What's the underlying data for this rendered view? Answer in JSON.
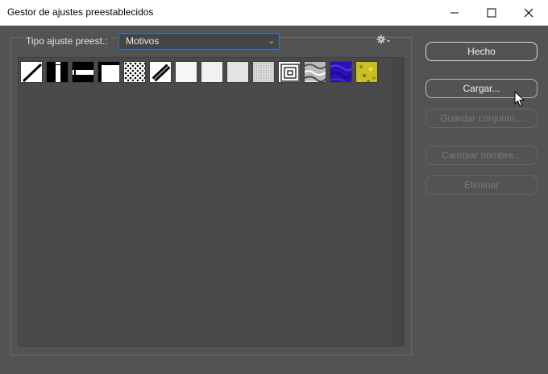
{
  "window": {
    "title": "Gestor de ajustes preestablecidos",
    "controls": [
      "minimize-icon",
      "maximize-icon",
      "close-icon"
    ]
  },
  "preset_type": {
    "label": "Tipo ajuste preest.:",
    "value": "Motivos"
  },
  "options_icon": "gear-icon",
  "patterns": [
    {
      "name": "diagonal-line-pattern",
      "fill": "#ffffff"
    },
    {
      "name": "vertical-bar-pattern",
      "fill": "#ffffff"
    },
    {
      "name": "horizontal-bar-pattern",
      "fill": "#ffffff"
    },
    {
      "name": "corner-pattern",
      "fill": "#ffffff"
    },
    {
      "name": "dots-pattern",
      "fill": "#ffffff"
    },
    {
      "name": "diagonal-block-pattern",
      "fill": "#ffffff"
    },
    {
      "name": "light-noise-pattern",
      "fill": "#f8f8f8"
    },
    {
      "name": "light-noise-pattern-2",
      "fill": "#f2f2f2"
    },
    {
      "name": "gray-noise-pattern",
      "fill": "#e6e6e6"
    },
    {
      "name": "gray-grain-pattern",
      "fill": "#d4d4d4"
    },
    {
      "name": "concentric-squares-pattern",
      "fill": "#ffffff"
    },
    {
      "name": "marble-pattern",
      "fill": "#bcbcbc"
    },
    {
      "name": "blue-texture-pattern",
      "fill": "#2a10b8"
    },
    {
      "name": "yellow-texture-pattern",
      "fill": "#c8c020"
    }
  ],
  "buttons": {
    "done": "Hecho",
    "load": "Cargar...",
    "save_set": "Guardar conjunto...",
    "rename": "Cambiar nombre...",
    "delete": "Eliminar"
  },
  "colors": {
    "background": "#535353",
    "select_border": "#2d76c9",
    "disabled_text": "#7c7c7c"
  }
}
